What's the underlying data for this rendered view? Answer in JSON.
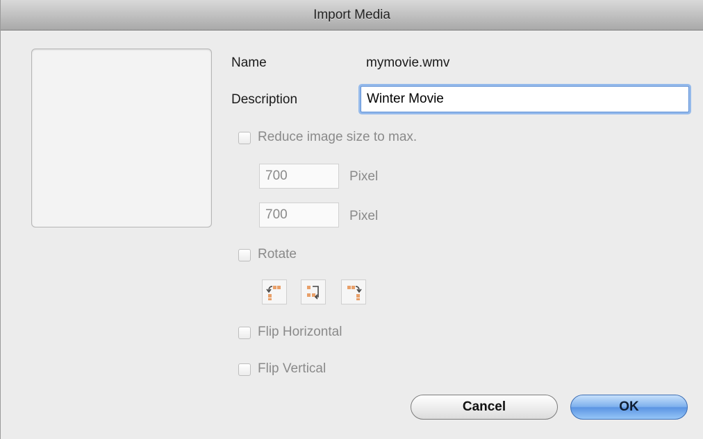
{
  "window": {
    "title": "Import Media"
  },
  "form": {
    "name_label": "Name",
    "name_value": "mymovie.wmv",
    "description_label": "Description",
    "description_value": "Winter Movie",
    "reduce_label": "Reduce image size to max.",
    "width_value": "700",
    "height_value": "700",
    "pixel_unit": "Pixel",
    "rotate_label": "Rotate",
    "rotate_buttons": [
      "rotate-left-icon",
      "rotate-180-icon",
      "rotate-right-icon"
    ],
    "flip_horizontal_label": "Flip Horizontal",
    "flip_vertical_label": "Flip Vertical"
  },
  "buttons": {
    "cancel": "Cancel",
    "ok": "OK"
  },
  "colors": {
    "accent": "#5b95e3",
    "icon_orange": "#e8a06a",
    "disabled_text": "#8a8a8a"
  }
}
